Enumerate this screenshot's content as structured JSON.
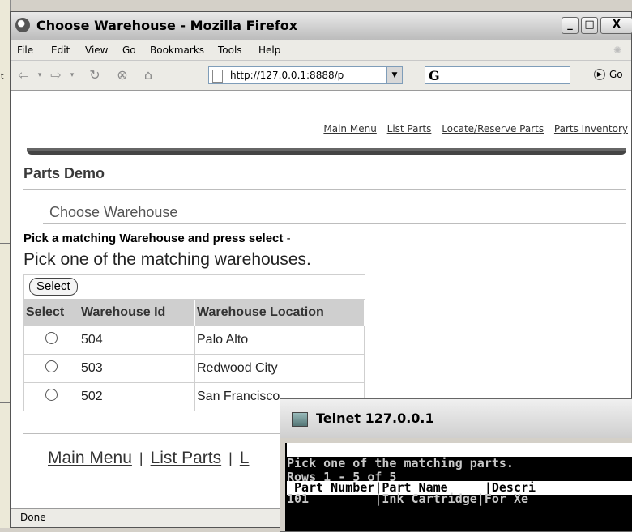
{
  "background": {
    "fragment_text": "t"
  },
  "window": {
    "title": "Choose Warehouse - Mozilla Firefox",
    "controls": {
      "minimize": "_",
      "maximize": "□",
      "close": "X"
    }
  },
  "menu": [
    "File",
    "Edit",
    "View",
    "Go",
    "Bookmarks",
    "Tools",
    "Help"
  ],
  "toolbar": {
    "url": "http://127.0.0.1:8888/p",
    "search_placeholder": "",
    "go_label": "Go"
  },
  "page": {
    "top_nav": [
      "Main Menu",
      "List Parts",
      "Locate/Reserve Parts",
      "Parts Inventory"
    ],
    "title": "Parts Demo",
    "subtitle": "Choose Warehouse",
    "prompt": "Pick a matching Warehouse and press select",
    "prompt_suffix": " -",
    "instruction": "Pick one of the matching warehouses.",
    "select_button": "Select",
    "table": {
      "headers": [
        "Select",
        "Warehouse Id",
        "Warehouse Location"
      ],
      "rows": [
        {
          "id": "504",
          "location": "Palo Alto"
        },
        {
          "id": "503",
          "location": "Redwood City"
        },
        {
          "id": "502",
          "location": "San Francisco"
        }
      ]
    },
    "bottom_nav": {
      "main_menu": "Main Menu",
      "list_parts": "List Parts",
      "next": "L",
      "sep": "|"
    }
  },
  "status": "Done",
  "telnet": {
    "title": "Telnet 127.0.0.1",
    "lines": [
      "",
      "Pick one of the matching parts.",
      "",
      "Rows 1 - 5 of 5",
      " Part Number|Part Name     |Descri",
      "101         |Ink Cartridge|For Xe"
    ]
  },
  "colors": {
    "nav_bar": "#444444",
    "header_bg": "#cfcfcf",
    "terminal_bg": "#000000"
  }
}
